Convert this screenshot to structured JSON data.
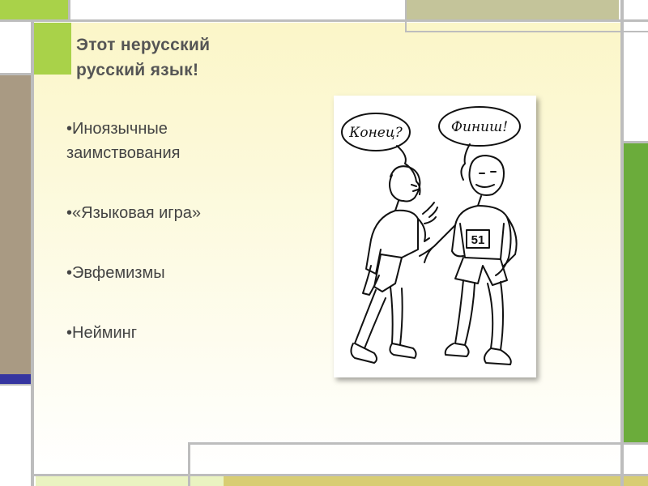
{
  "slide": {
    "title_line1": "Этот нерусский",
    "title_line2": "русский язык!",
    "bullets": [
      {
        "line1": "•Иноязычные",
        "line2": "заимствования"
      },
      {
        "line1": "•«Языковая игра»"
      },
      {
        "line1": "•Эвфемизмы"
      },
      {
        "line1": "•Нейминг"
      }
    ],
    "cartoon": {
      "left_bubble": "Конец?",
      "right_bubble": "Финиш!",
      "bib_number": "51"
    }
  },
  "colors": {
    "green_accent": "#a9d249",
    "olive": "#c4c49a",
    "taupe": "#a99a83",
    "indigo": "#3535a0",
    "green_right": "#6bac3b",
    "gold_bottom": "#d8cd73",
    "light_lime": "#eaf3c1",
    "title_text": "#555555",
    "body_text": "#444444"
  }
}
